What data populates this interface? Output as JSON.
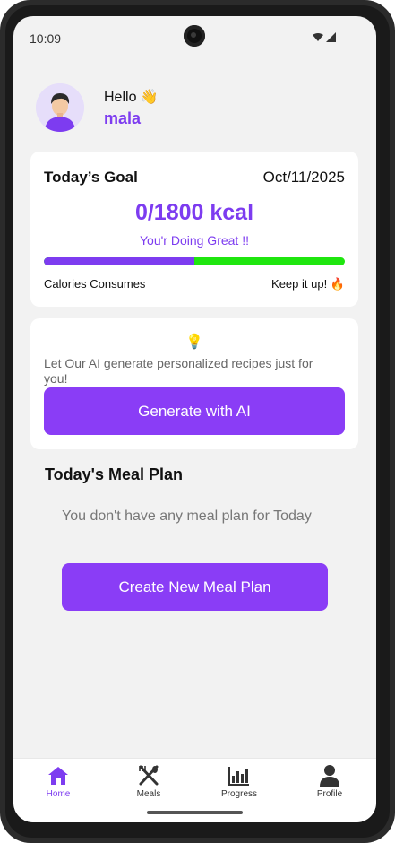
{
  "status_bar": {
    "time": "10:09"
  },
  "header": {
    "greeting": "Hello 👋",
    "username": "mala"
  },
  "goal_card": {
    "title": "Today’s Goal",
    "date": "Oct/11/2025",
    "calories": "0/1800 kcal",
    "message": "You'r Doing Great !!",
    "progress_percent": 50,
    "left_caption": "Calories Consumes",
    "right_caption": "Keep it up! 🔥"
  },
  "ai_card": {
    "icon": "💡",
    "text": "Let Our AI generate personalized recipes just for you!",
    "button_label": "Generate with AI"
  },
  "meal_plan": {
    "title": "Today's Meal Plan",
    "empty_text": "You don't have any meal plan for Today",
    "button_label": "Create New Meal Plan"
  },
  "nav": {
    "items": [
      {
        "label": "Home",
        "icon": "home-icon",
        "active": true
      },
      {
        "label": "Meals",
        "icon": "utensils-icon",
        "active": false
      },
      {
        "label": "Progress",
        "icon": "chart-icon",
        "active": false
      },
      {
        "label": "Profile",
        "icon": "user-icon",
        "active": false
      }
    ]
  },
  "colors": {
    "accent": "#7d3cf0",
    "button": "#8a3df6",
    "progress_remaining": "#1fe60f",
    "background": "#f2f2f2"
  }
}
